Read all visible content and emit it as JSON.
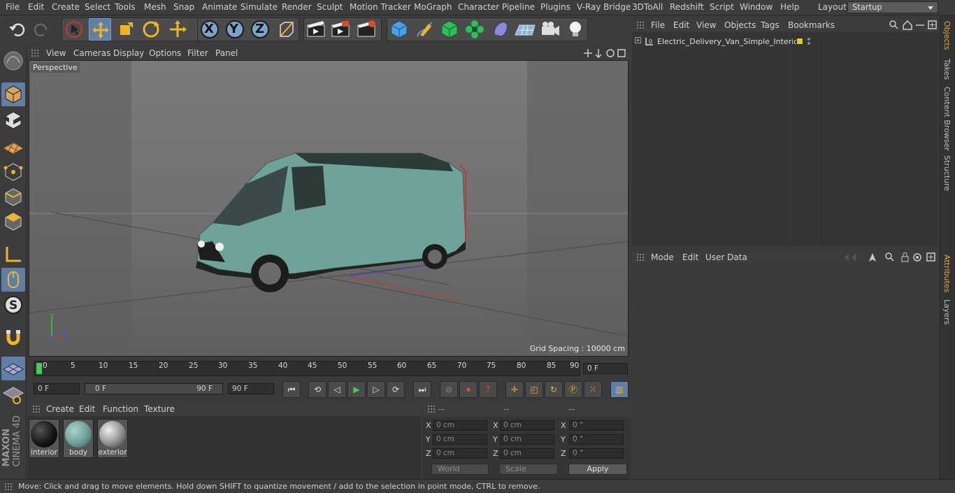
{
  "menubar": {
    "items": [
      "File",
      "Edit",
      "Create",
      "Select",
      "Tools",
      "Mesh",
      "Snap",
      "Animate",
      "Simulate",
      "Render",
      "Sculpt",
      "Motion Tracker",
      "MoGraph",
      "Character",
      "Pipeline",
      "Plugins",
      "V-Ray Bridge",
      "3DToAll",
      "Redshift",
      "Script",
      "Window",
      "Help"
    ],
    "layout_label": "Layout:",
    "layout_value": "Startup"
  },
  "toolbar": {
    "axis": {
      "x": "X",
      "y": "Y",
      "z": "Z"
    }
  },
  "viewport": {
    "menu": [
      "View",
      "Cameras",
      "Display",
      "Options",
      "Filter",
      "Panel"
    ],
    "label": "Perspective",
    "grid_spacing": "Grid Spacing : 10000 cm"
  },
  "timeline": {
    "ticks": [
      "0",
      "5",
      "10",
      "15",
      "20",
      "25",
      "30",
      "35",
      "40",
      "45",
      "50",
      "55",
      "60",
      "65",
      "70",
      "75",
      "80",
      "85",
      "90"
    ],
    "current_frame": "0 F",
    "start_field": "0 F",
    "range_start": "0 F",
    "range_end": "90 F",
    "end_field": "90 F"
  },
  "materials": {
    "menu": [
      "Create",
      "Edit",
      "Function",
      "Texture"
    ],
    "items": [
      {
        "name": "interior",
        "color": "#1a1a1a"
      },
      {
        "name": "body",
        "color": "#6f9e96"
      },
      {
        "name": "exterior",
        "color": "#9a9a9a"
      }
    ]
  },
  "coordinates": {
    "headers": [
      "--",
      "--",
      "--"
    ],
    "rows": [
      {
        "a": "X",
        "v1": "0 cm",
        "b": "X",
        "v2": "0 cm",
        "c": "X",
        "v3": "0 °"
      },
      {
        "a": "Y",
        "v1": "0 cm",
        "b": "Y",
        "v2": "0 cm",
        "c": "Y",
        "v3": "0 °"
      },
      {
        "a": "Z",
        "v1": "0 cm",
        "b": "Z",
        "v2": "0 cm",
        "c": "Z",
        "v3": "0 °"
      }
    ],
    "mode": "World",
    "scale": "Scale",
    "apply": "Apply"
  },
  "objects": {
    "menu": [
      "File",
      "Edit",
      "View",
      "Objects",
      "Tags",
      "Bookmarks"
    ],
    "item_name": "Electric_Delivery_Van_Simple_Interior",
    "layer_color": "#e0d020"
  },
  "attributes": {
    "menu": [
      "Mode",
      "Edit",
      "User Data"
    ]
  },
  "right_tabs": [
    "Objects",
    "Takes",
    "Content Browser",
    "Structure",
    "Attributes",
    "Layers"
  ],
  "brand": {
    "line1": "MAXON",
    "line2": "CINEMA 4D"
  },
  "status": "Move: Click and drag to move elements. Hold down SHIFT to quantize movement / add to the selection in point mode, CTRL to remove."
}
